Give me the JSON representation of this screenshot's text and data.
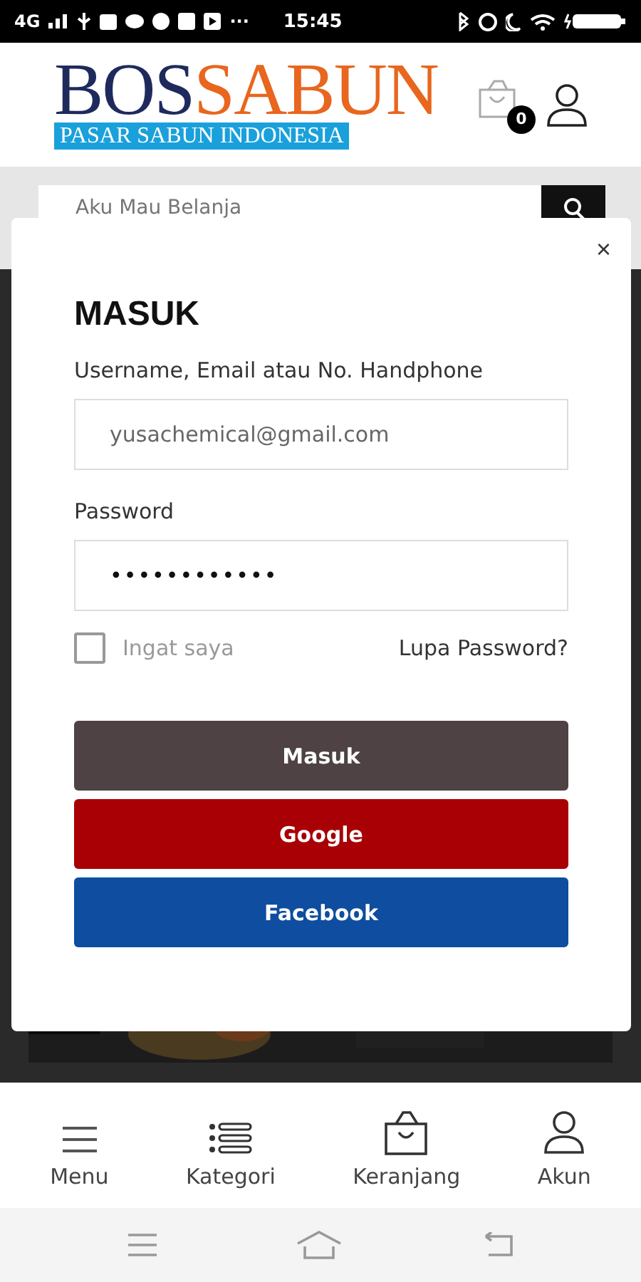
{
  "status_bar": {
    "network": "4G",
    "more": "···",
    "time": "15:45"
  },
  "header": {
    "logo": {
      "part_1": "BOS",
      "part_2": "SABUN",
      "tagline": "PASAR SABUN INDONESIA"
    },
    "cart_count": "0"
  },
  "search": {
    "placeholder": "Aku Mau Belanja"
  },
  "login_modal": {
    "close": "×",
    "title": "MASUK",
    "username_label": "Username, Email atau No. Handphone",
    "username_value": "yusachemical@gmail.com",
    "password_label": "Password",
    "password_value": "••••••••••••",
    "remember": {
      "label": "Ingat saya",
      "checked": false
    },
    "forgot": "Lupa Password?",
    "buttons": [
      {
        "label": "Masuk",
        "kind": "submit"
      },
      {
        "label": "Google",
        "kind": "google"
      },
      {
        "label": "Facebook",
        "kind": "facebook"
      }
    ]
  },
  "bottom_nav": [
    {
      "label": "Menu",
      "kind": "menu"
    },
    {
      "label": "Kategori",
      "kind": "list"
    },
    {
      "label": "Keranjang",
      "kind": "bag"
    },
    {
      "label": "Akun",
      "kind": "user"
    }
  ]
}
